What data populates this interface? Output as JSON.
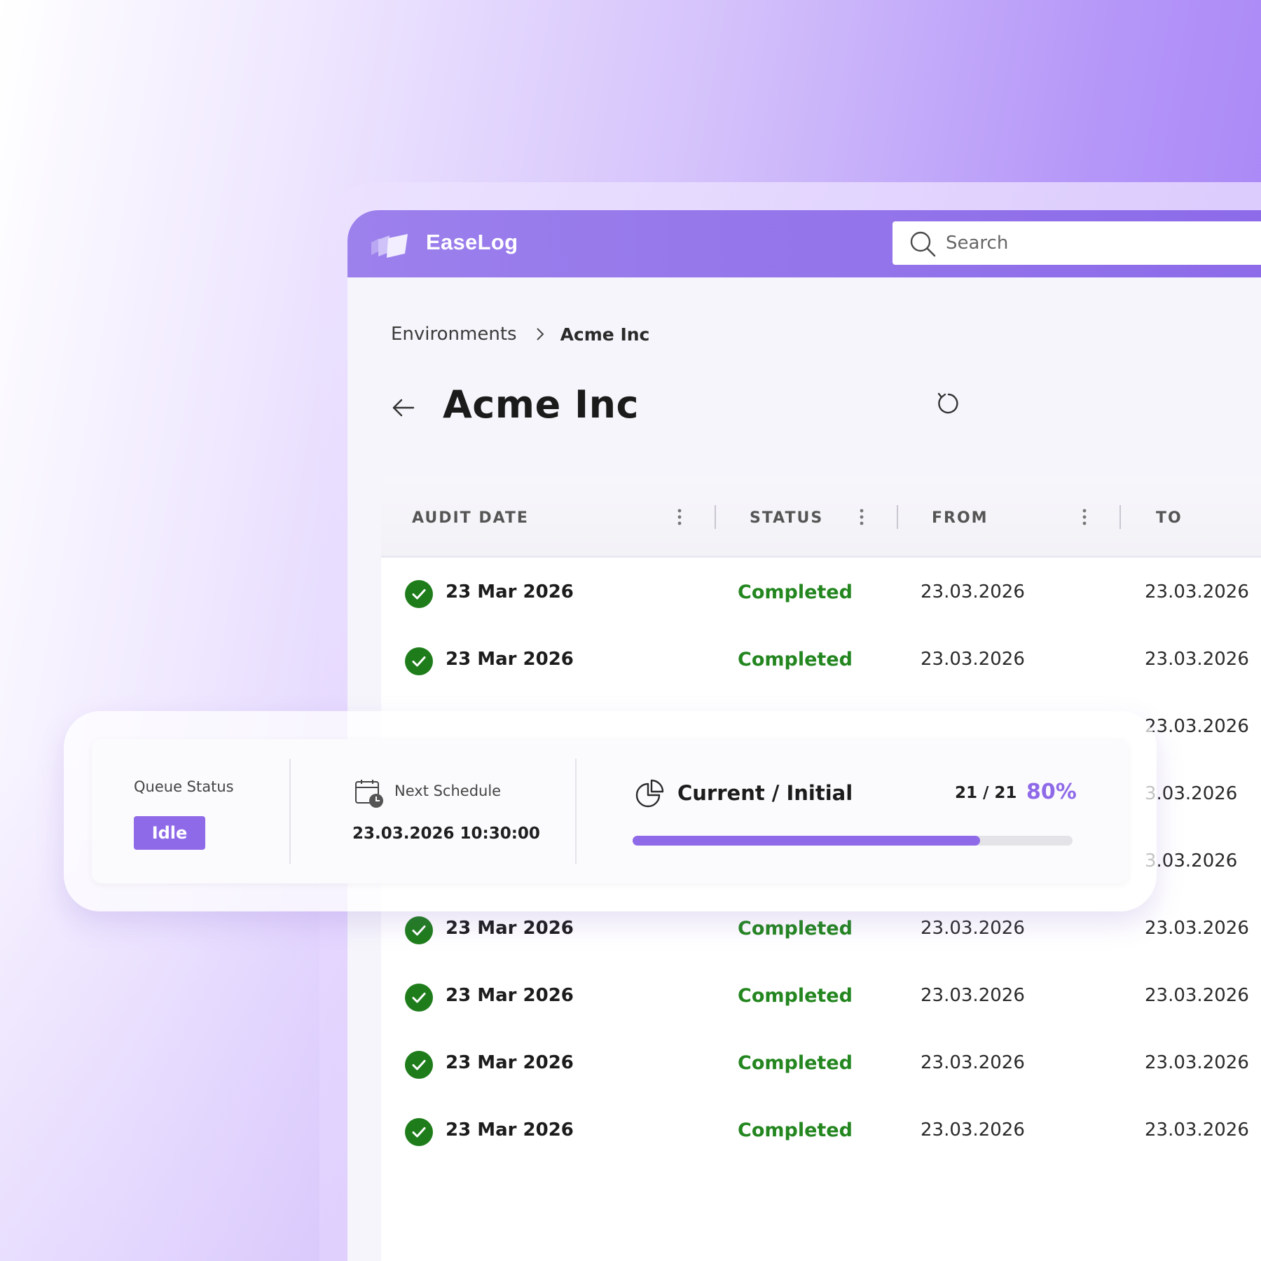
{
  "app": {
    "name": "EaseLog",
    "logo_icon": "app-logo-icon"
  },
  "search": {
    "placeholder": "Search",
    "icon": "search-icon"
  },
  "breadcrumb": {
    "parent": "Environments",
    "current": "Acme Inc"
  },
  "page": {
    "title": "Acme Inc",
    "back_icon": "arrow-left-icon",
    "refresh_icon": "refresh-icon"
  },
  "table": {
    "columns": [
      "AUDIT DATE",
      "STATUS",
      "FROM",
      "TO"
    ],
    "rows": [
      {
        "audit_date": "23 Mar 2026",
        "status": "Completed",
        "from": "23.03.2026",
        "to": "23.03.2026"
      },
      {
        "audit_date": "23 Mar 2026",
        "status": "Completed",
        "from": "23.03.2026",
        "to": "23.03.2026"
      },
      {
        "audit_date": "",
        "status": "",
        "from": "",
        "to": "23.03.2026"
      },
      {
        "audit_date": "",
        "status": "",
        "from": "",
        "to": "3.03.2026"
      },
      {
        "audit_date": "",
        "status": "",
        "from": "",
        "to": "3.03.2026"
      },
      {
        "audit_date": "23 Mar 2026",
        "status": "Completed",
        "from": "23.03.2026",
        "to": "23.03.2026"
      },
      {
        "audit_date": "23 Mar 2026",
        "status": "Completed",
        "from": "23.03.2026",
        "to": "23.03.2026"
      },
      {
        "audit_date": "23 Mar 2026",
        "status": "Completed",
        "from": "23.03.2026",
        "to": "23.03.2026"
      },
      {
        "audit_date": "23 Mar 2026",
        "status": "Completed",
        "from": "23.03.2026",
        "to": "23.03.2026"
      }
    ]
  },
  "status_card": {
    "queue_label": "Queue Status",
    "queue_value": "Idle",
    "schedule_label": "Next Schedule",
    "schedule_value": "23.03.2026 10:30:00",
    "schedule_icon": "calendar-clock-icon",
    "progress_icon": "pie-chart-icon",
    "progress_title": "Current / Initial",
    "progress_count": "21 / 21",
    "progress_percent_label": "80%",
    "progress_fraction": 0.79
  },
  "colors": {
    "accent": "#8f6ae8",
    "topbar": "#9077eb",
    "success": "#23861f"
  }
}
